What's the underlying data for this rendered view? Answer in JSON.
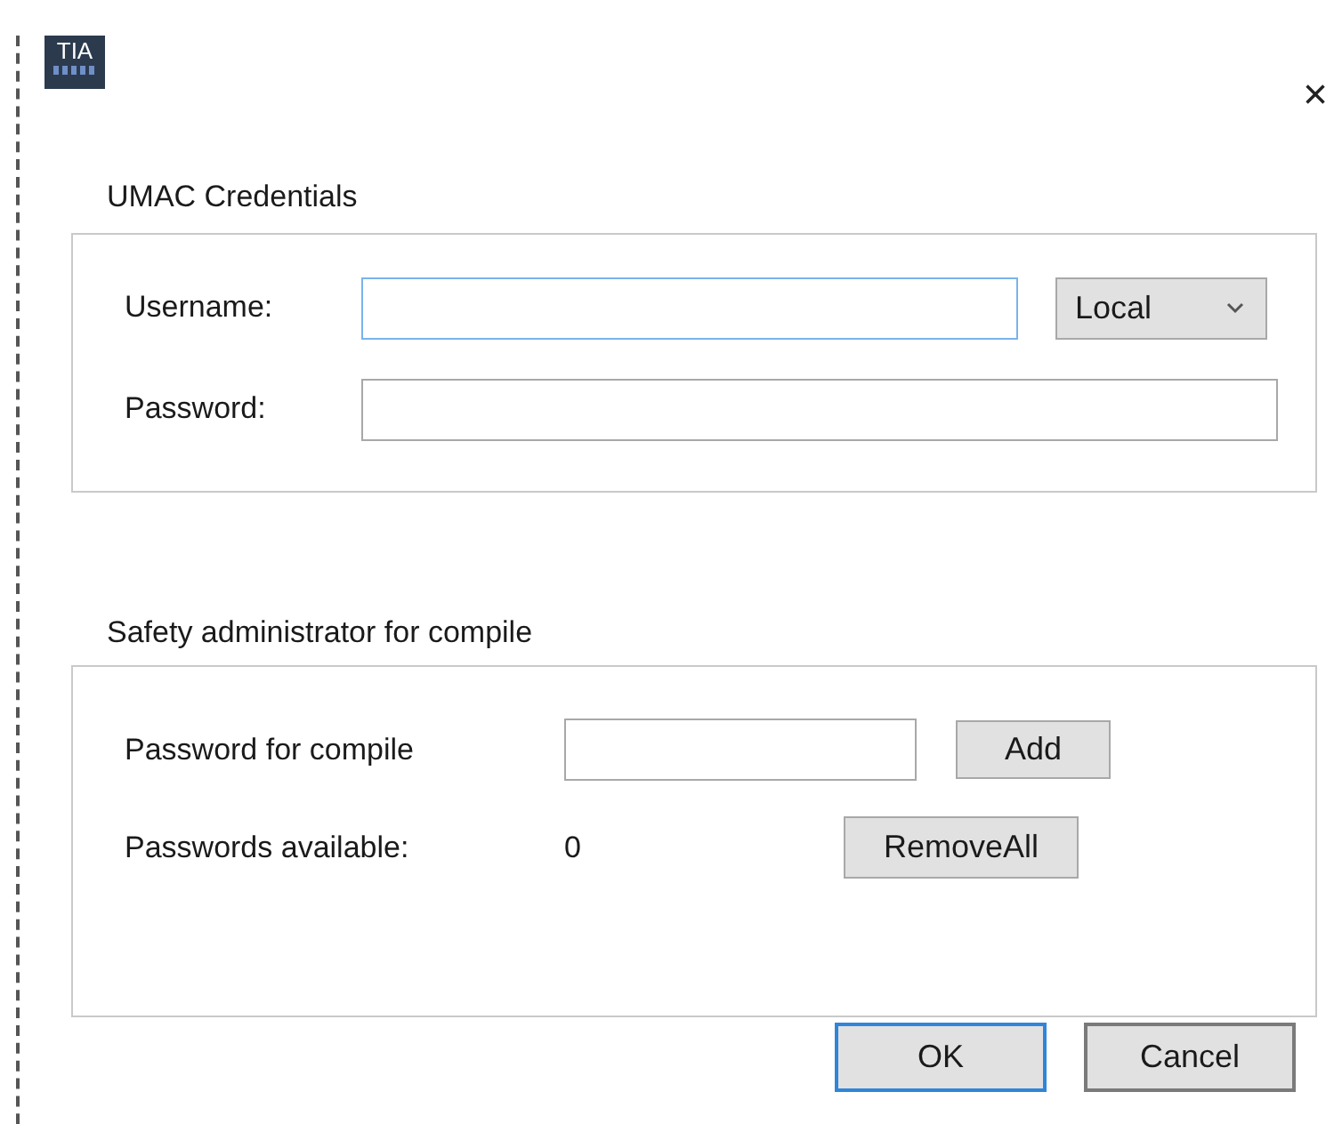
{
  "window": {
    "logo": "TIA",
    "close": "×"
  },
  "credentials": {
    "title": "UMAC Credentials",
    "username": {
      "label": "Username:",
      "focused": true
    },
    "scope": {
      "value": "Local"
    },
    "password": {
      "label": "Password:",
      "focused": false
    }
  },
  "safety": {
    "title": "Safety administrator for compile",
    "compile_password": {
      "label": "Password for compile"
    },
    "add_button": "Add",
    "available_label": "Passwords available:",
    "available_count": "0",
    "remove_button": "RemoveAll"
  },
  "buttons": [
    {
      "label": "OK",
      "default": true
    },
    {
      "label": "Cancel",
      "default": false
    }
  ]
}
